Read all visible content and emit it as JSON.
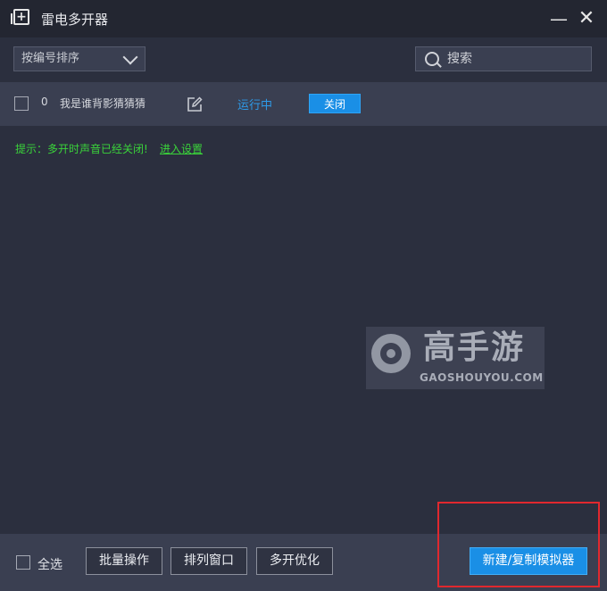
{
  "window": {
    "title": "雷电多开器",
    "icons": {
      "app": "app-window-icon",
      "minimize": "minimize-icon",
      "close": "close-icon"
    },
    "minimize_glyph": "—",
    "close_glyph": "✕"
  },
  "toolbar": {
    "sort_value": "按编号排序",
    "search_placeholder": "搜索"
  },
  "instances": [
    {
      "index": "0",
      "name": "我是谁背影猜猜猜",
      "status": "运行中",
      "action_label": "关闭"
    }
  ],
  "tip": {
    "text": "提示：多开时声音已经关闭!",
    "link": "进入设置"
  },
  "watermark": {
    "cn": "高手游",
    "en": "GAOSHOUYOU.COM"
  },
  "footer": {
    "select_all_label": "全选",
    "batch_label": "批量操作",
    "arrange_label": "排列窗口",
    "optimize_label": "多开优化",
    "new_label": "新建/复制模拟器"
  },
  "colors": {
    "accent": "#1a8fe6",
    "status": "#2e9be9",
    "tip": "#3ad43a",
    "highlight": "#e0282e"
  }
}
